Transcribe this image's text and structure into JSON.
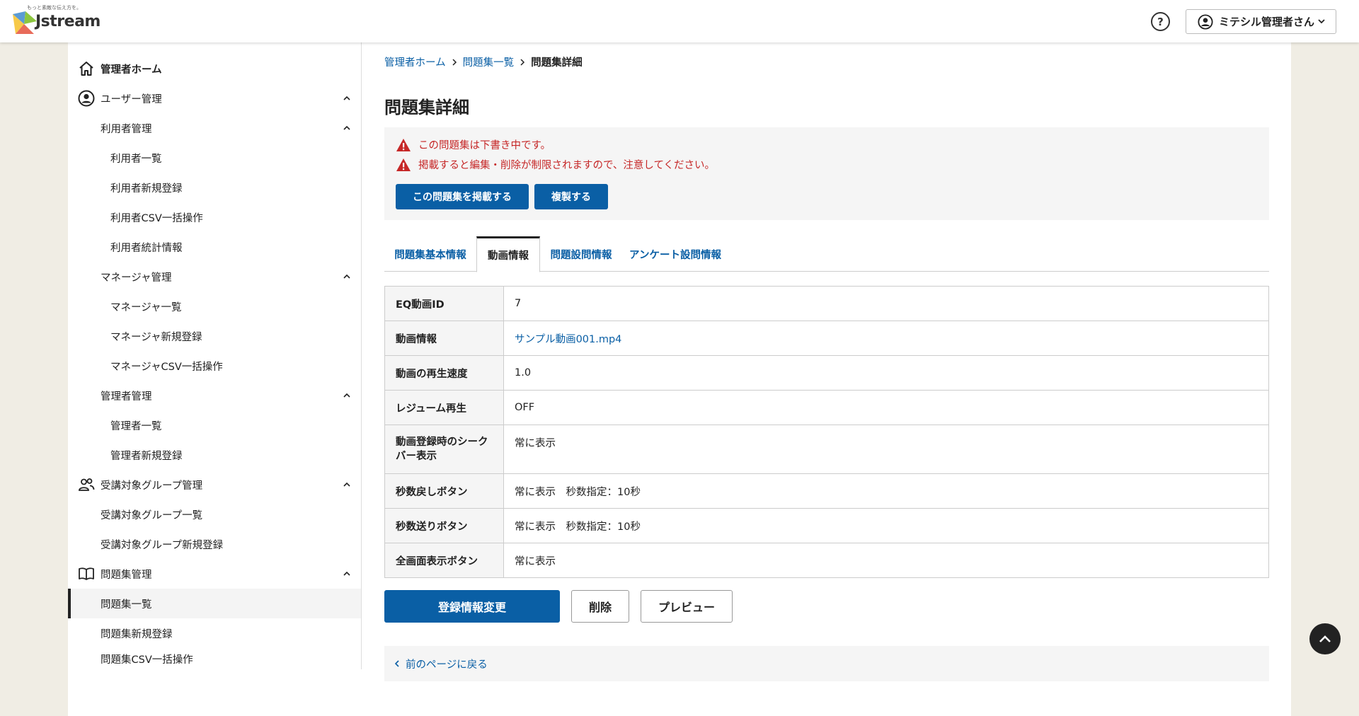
{
  "header": {
    "logo_tagline": "もっと素敵な伝え方を。",
    "logo_text": "Jstream",
    "help_glyph": "?",
    "user_name": "ミテシル管理者さん"
  },
  "sidebar": {
    "admin_home": "管理者ホーム",
    "user_mgmt": "ユーザー管理",
    "user_admin": "利用者管理",
    "user_list": "利用者一覧",
    "user_new": "利用者新規登録",
    "user_csv": "利用者CSV一括操作",
    "user_stats": "利用者統計情報",
    "manager_mgmt": "マネージャ管理",
    "manager_list": "マネージャ一覧",
    "manager_new": "マネージャ新規登録",
    "manager_csv": "マネージャCSV一括操作",
    "admin_mgmt": "管理者管理",
    "admin_list": "管理者一覧",
    "admin_new": "管理者新規登録",
    "group_mgmt": "受講対象グループ管理",
    "group_list": "受講対象グループ一覧",
    "group_new": "受講対象グループ新規登録",
    "workbook_mgmt": "問題集管理",
    "workbook_list": "問題集一覧",
    "workbook_new": "問題集新規登録",
    "workbook_csv": "問題集CSV一括操作"
  },
  "breadcrumb": {
    "home": "管理者ホーム",
    "list": "問題集一覧",
    "current": "問題集詳細"
  },
  "page": {
    "title": "問題集詳細"
  },
  "alert": {
    "line1": "この問題集は下書き中です。",
    "line2": "掲載すると編集・削除が制限されますので、注意してください。",
    "publish_button": "この問題集を掲載する",
    "duplicate_button": "複製する"
  },
  "tabs": {
    "basic": "問題集基本情報",
    "video": "動画情報",
    "question": "問題設問情報",
    "survey": "アンケート設問情報"
  },
  "table": {
    "eq_id_label": "EQ動画ID",
    "eq_id_value": "7",
    "video_label": "動画情報",
    "video_value": "サンプル動画001.mp4",
    "speed_label": "動画の再生速度",
    "speed_value": "1.0",
    "resume_label": "レジューム再生",
    "resume_value": "OFF",
    "seekbar_label": "動画登録時のシークバー表示",
    "seekbar_value": "常に表示",
    "rewind_label": "秒数戻しボタン",
    "rewind_value": "常に表示　秒数指定：10秒",
    "forward_label": "秒数送りボタン",
    "forward_value": "常に表示　秒数指定：10秒",
    "fullscreen_label": "全画面表示ボタン",
    "fullscreen_value": "常に表示"
  },
  "actions": {
    "edit": "登録情報変更",
    "delete": "削除",
    "preview": "プレビュー",
    "back": "前のページに戻る"
  },
  "colors": {
    "primary": "#0a5fa5",
    "alert": "#c62828",
    "background": "#f0ede4"
  }
}
